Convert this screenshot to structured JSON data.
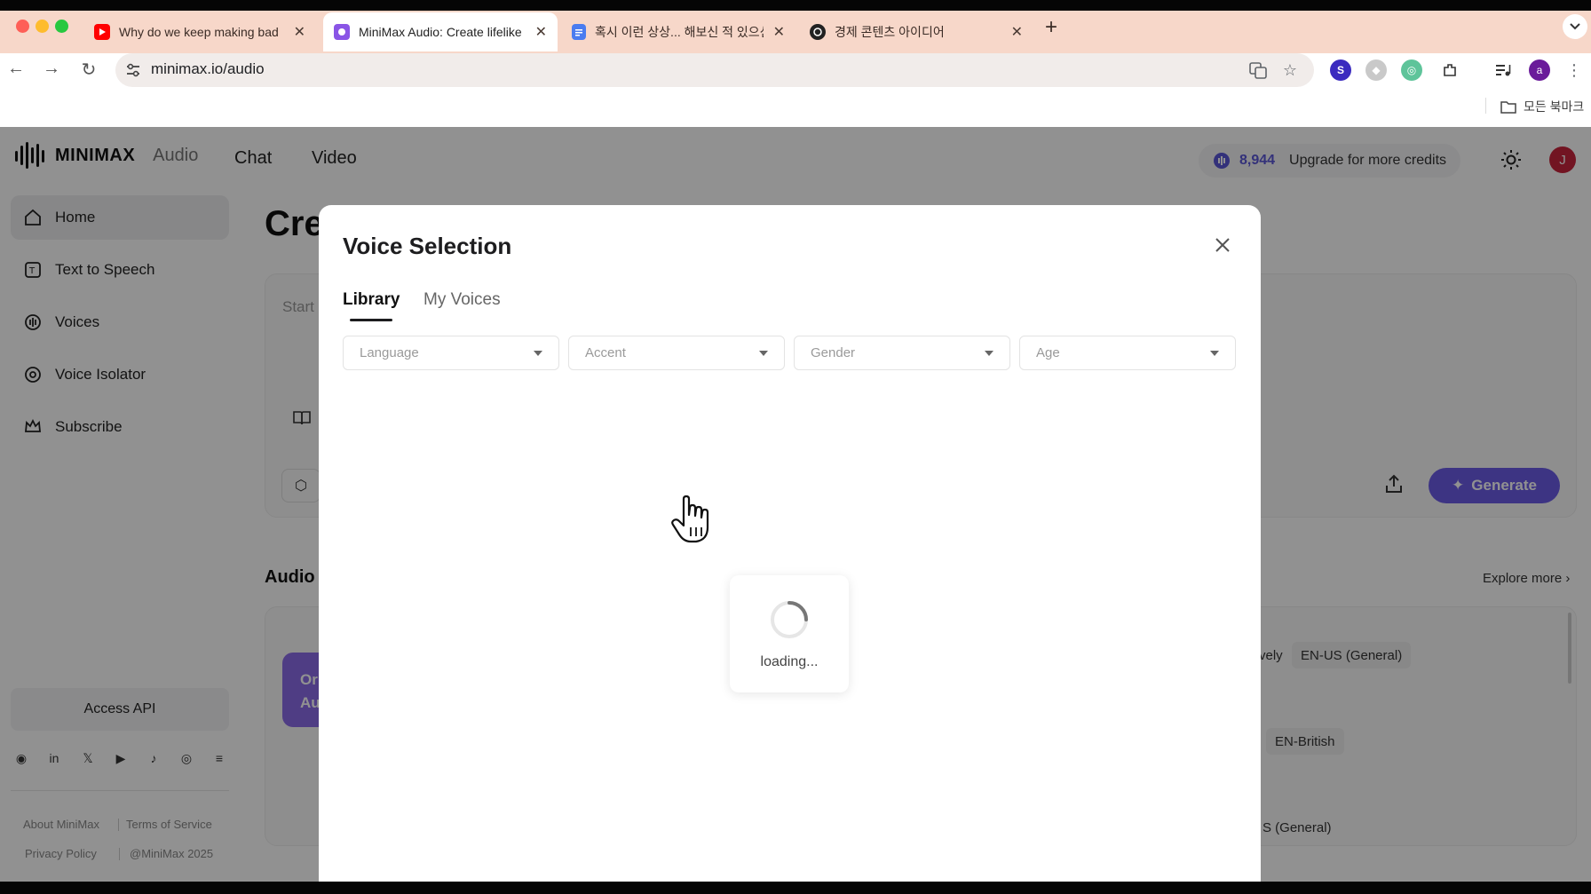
{
  "browser": {
    "tabs": [
      {
        "title": "Why do we keep making bad",
        "favicon": "youtube-icon",
        "active": false
      },
      {
        "title": "MiniMax Audio: Create lifelike",
        "favicon": "minimax-icon",
        "active": true
      },
      {
        "title": "혹시 이런 상상... 해보신 적 있으신",
        "favicon": "docs-icon",
        "active": false
      },
      {
        "title": "경제 콘텐츠 아이디어",
        "favicon": "openai-icon",
        "active": false
      }
    ],
    "new_tab_label": "+",
    "url": "minimax.io/audio",
    "bookmarks_label": "모든 북마크",
    "profile_initial": "a"
  },
  "app": {
    "logo_text": "MINIMAX",
    "logo_sub": "Audio",
    "nav": [
      "Chat",
      "Video"
    ],
    "credits": "8,944",
    "upgrade_label": "Upgrade for more credits",
    "user_initial": "J"
  },
  "sidebar": {
    "items": [
      {
        "label": "Home",
        "icon": "home-icon"
      },
      {
        "label": "Text to Speech",
        "icon": "tts-icon"
      },
      {
        "label": "Voices",
        "icon": "voices-icon"
      },
      {
        "label": "Voice Isolator",
        "icon": "isolator-icon"
      },
      {
        "label": "Subscribe",
        "icon": "crown-icon"
      }
    ],
    "access_api": "Access API",
    "footer": {
      "about": "About MiniMax",
      "terms": "Terms of Service",
      "privacy": "Privacy Policy",
      "copyright": "@MiniMax 2025"
    }
  },
  "main": {
    "title_partial": "Cre",
    "editor_placeholder_partial": "Start",
    "generate_label": "Generate",
    "section_title_partial": "Audio",
    "explore_more": "Explore more",
    "promo_partial": [
      "Or",
      "Au"
    ],
    "chips": [
      "vely",
      "EN-US (General)",
      "EN-British",
      "S (General)"
    ]
  },
  "modal": {
    "title": "Voice Selection",
    "tabs": [
      "Library",
      "My Voices"
    ],
    "active_tab": "Library",
    "filters": [
      {
        "placeholder": "Language"
      },
      {
        "placeholder": "Accent"
      },
      {
        "placeholder": "Gender"
      },
      {
        "placeholder": "Age"
      }
    ],
    "loading_text": "loading..."
  },
  "colors": {
    "tabstrip": "#f7d7c9",
    "accent": "#6b5ce7",
    "avatar": "#c8243c",
    "credits": "#5b57d6"
  }
}
